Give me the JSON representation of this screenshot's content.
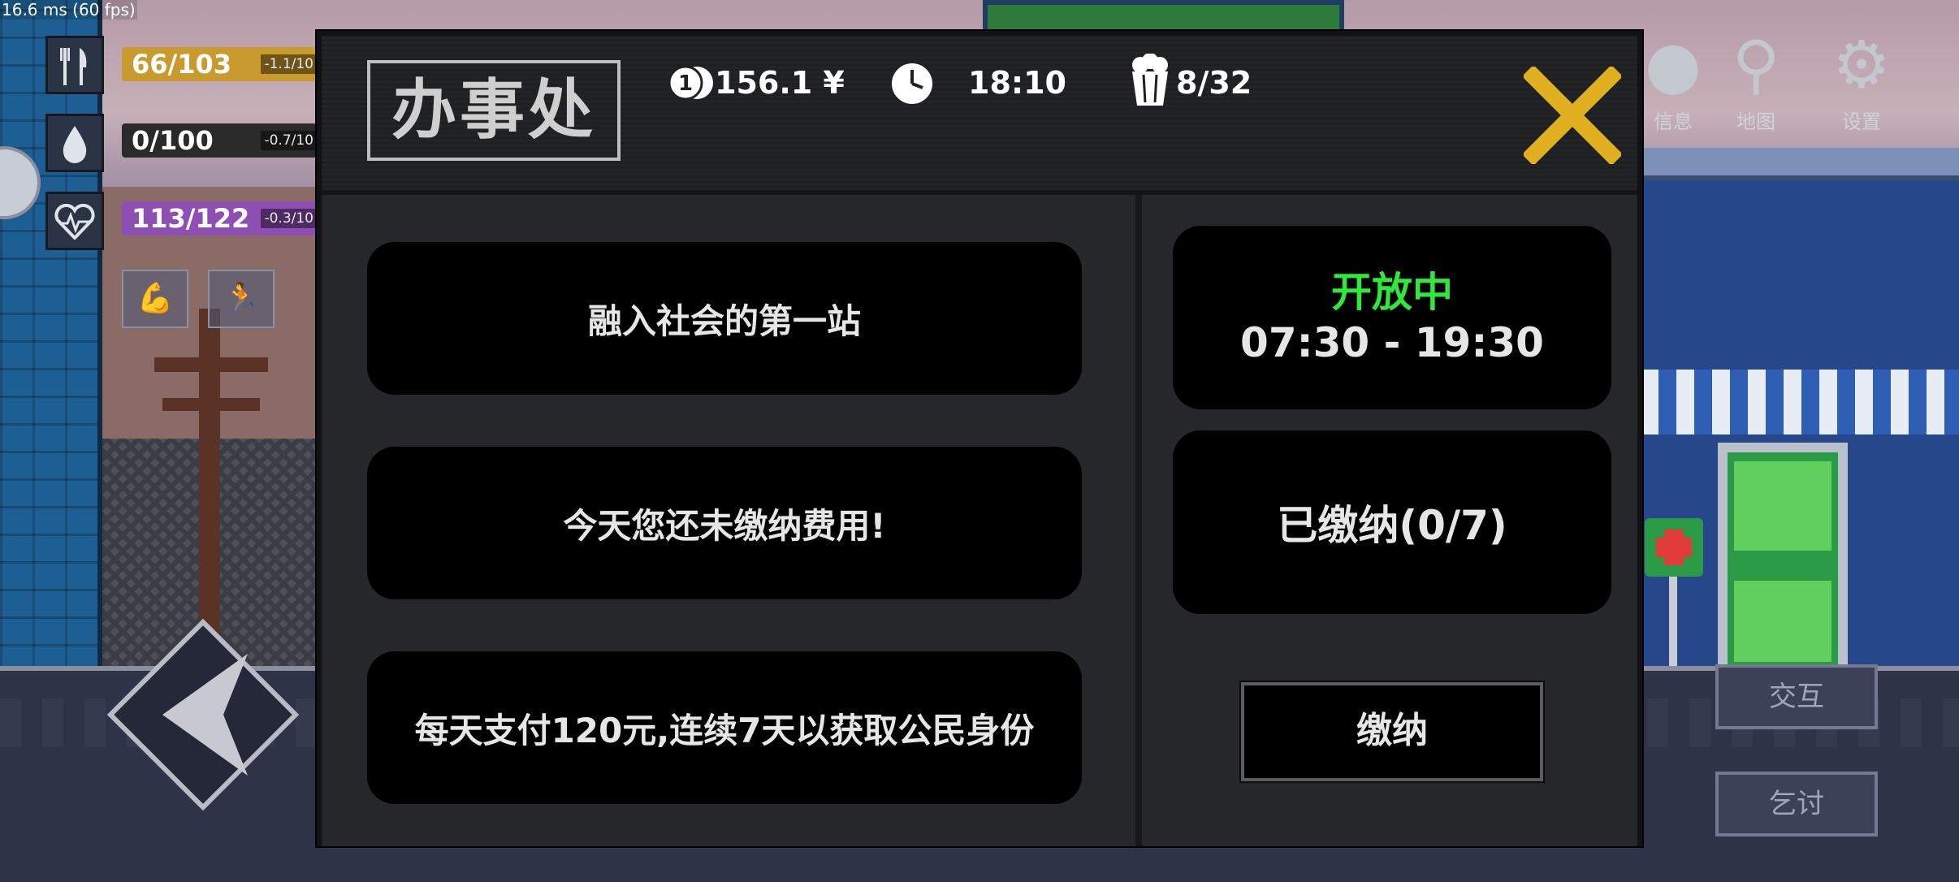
{
  "debug": {
    "fps_text": "16.6 ms (60 fps)"
  },
  "hud": {
    "stats": [
      {
        "icon": "fork-knife-icon",
        "value": "66/103",
        "rate": "-1.1/10",
        "color": "#c99a2e"
      },
      {
        "icon": "water-drop-icon",
        "value": "0/100",
        "rate": "-0.7/10",
        "color": "#3a3a3a"
      },
      {
        "icon": "heartbeat-icon",
        "value": "113/122",
        "rate": "-0.3/10",
        "color": "#8e4fb5"
      }
    ],
    "top_right": [
      {
        "icon": "person-info-icon",
        "label": "信息"
      },
      {
        "icon": "map-pin-icon",
        "label": "地图"
      },
      {
        "icon": "gear-icon",
        "label": "设置"
      }
    ],
    "side_buttons": {
      "interact": "交互",
      "beg": "乞讨"
    }
  },
  "dialog": {
    "title": "办事处",
    "money": "156.1 ¥",
    "time": "18:10",
    "capacity": "8/32",
    "left_cards": [
      "融入社会的第一站",
      "今天您还未缴纳费用!",
      "每天支付120元,连续7天以获取公民身份"
    ],
    "status": "开放中",
    "hours": "07:30 - 19:30",
    "paid": "已缴纳(0/7)",
    "pay_button": "缴纳",
    "status_color": "#2ee83a",
    "close_color": "#e0b020"
  }
}
